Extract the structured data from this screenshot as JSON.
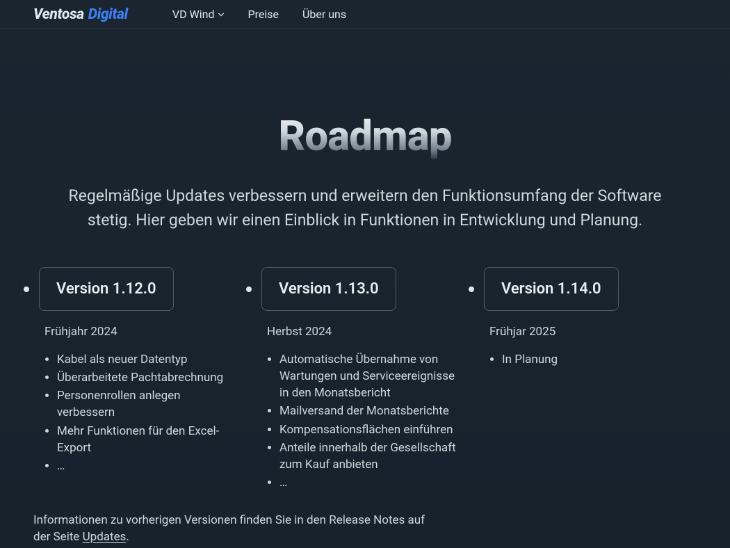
{
  "brand": {
    "word1": "Ventosa",
    "word2": "Digital"
  },
  "nav": {
    "items": [
      {
        "label": "VD Wind",
        "hasDropdown": true
      },
      {
        "label": "Preise"
      },
      {
        "label": "Über uns"
      }
    ]
  },
  "hero": {
    "title": "Roadmap",
    "subtitle": "Regelmäßige Updates verbessern und erweitern den Funktionsumfang der Software stetig. Hier geben wir einen Einblick in Funktionen in Entwicklung und Planung."
  },
  "roadmap": {
    "columns": [
      {
        "version": "Version 1.12.0",
        "date": "Frühjahr 2024",
        "features": [
          "Kabel als neuer Datentyp",
          "Überarbeitete Pachtabrechnung",
          "Personenrollen anlegen verbessern",
          "Mehr Funktionen für den Excel-Export",
          "…"
        ]
      },
      {
        "version": "Version 1.13.0",
        "date": "Herbst 2024",
        "features": [
          "Automatische Übernahme von Wartungen und Serviceereignisse in den Monatsbericht",
          "Mailversand der Monatsberichte",
          "Kompensationsflächen einführen",
          "Anteile innerhalb der Gesellschaft zum Kauf anbieten",
          "…"
        ]
      },
      {
        "version": "Version 1.14.0",
        "date": "Frühjar 2025",
        "features": [
          "In Planung"
        ]
      }
    ]
  },
  "footer": {
    "prefix": "Informationen zu vorherigen Versionen finden Sie in den Release Notes auf der Seite ",
    "link": "Updates",
    "suffix": "."
  }
}
